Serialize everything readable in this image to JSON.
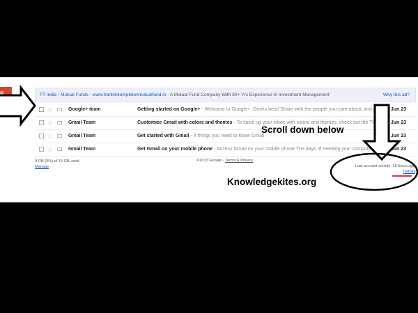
{
  "compose_button": {
    "label": "E",
    "color": "#d14836"
  },
  "ad": {
    "source": "FT India",
    "separator1": " - ",
    "category": "Mutual Funds",
    "separator2": " - ",
    "url": "www.franklintempletonmutualfund.in",
    "text": " - A Mutual Fund Company With 60+ Yrs Experience In Investment Management",
    "why_label": "Why this ad?"
  },
  "emails": [
    {
      "sender": "Google+ team",
      "subject": "Getting started on Google+",
      "snippet": " - Welcome to Google+, Geeks best! Share with the people you care about, and exp",
      "date": "Jun 23"
    },
    {
      "sender": "Gmail Team",
      "subject": "Customize Gmail with colors and themes",
      "snippet": " - To spice up your inbox with colors and themes, check out the Them",
      "date": "Jun 23"
    },
    {
      "sender": "Gmail Team",
      "subject": "Get started with Gmail",
      "snippet": " - 4 things you need to know Gmail",
      "date": "Jun 23"
    },
    {
      "sender": "Gmail Team",
      "subject": "Get Gmail on your mobile phone",
      "snippet": " - Access Gmail on your mobile phone The days of needing your computer t",
      "date": "Jun 23"
    }
  ],
  "footer": {
    "storage": "0 GB (0%) of 15 GB used",
    "manage": "Manage",
    "copyright": "©2013 Google - ",
    "terms": "Terms & Privacy",
    "activity": "Last account activity: 16 hours ago",
    "details": "Details"
  },
  "annotations": {
    "scroll_text": "Scroll down below",
    "site_text": "Knowledgekites.org",
    "accent": "#e23030"
  }
}
